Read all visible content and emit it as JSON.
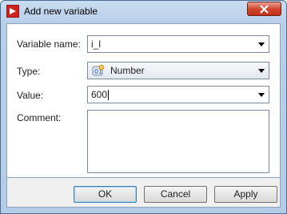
{
  "window": {
    "title": "Add new variable"
  },
  "form": {
    "variable_name_label": "Variable name:",
    "variable_name_value": "i_l",
    "type_label": "Type:",
    "type_value": "Number",
    "value_label": "Value:",
    "value_value": "600",
    "comment_label": "Comment:",
    "comment_value": ""
  },
  "buttons": {
    "ok": "OK",
    "cancel": "Cancel",
    "apply": "Apply"
  }
}
